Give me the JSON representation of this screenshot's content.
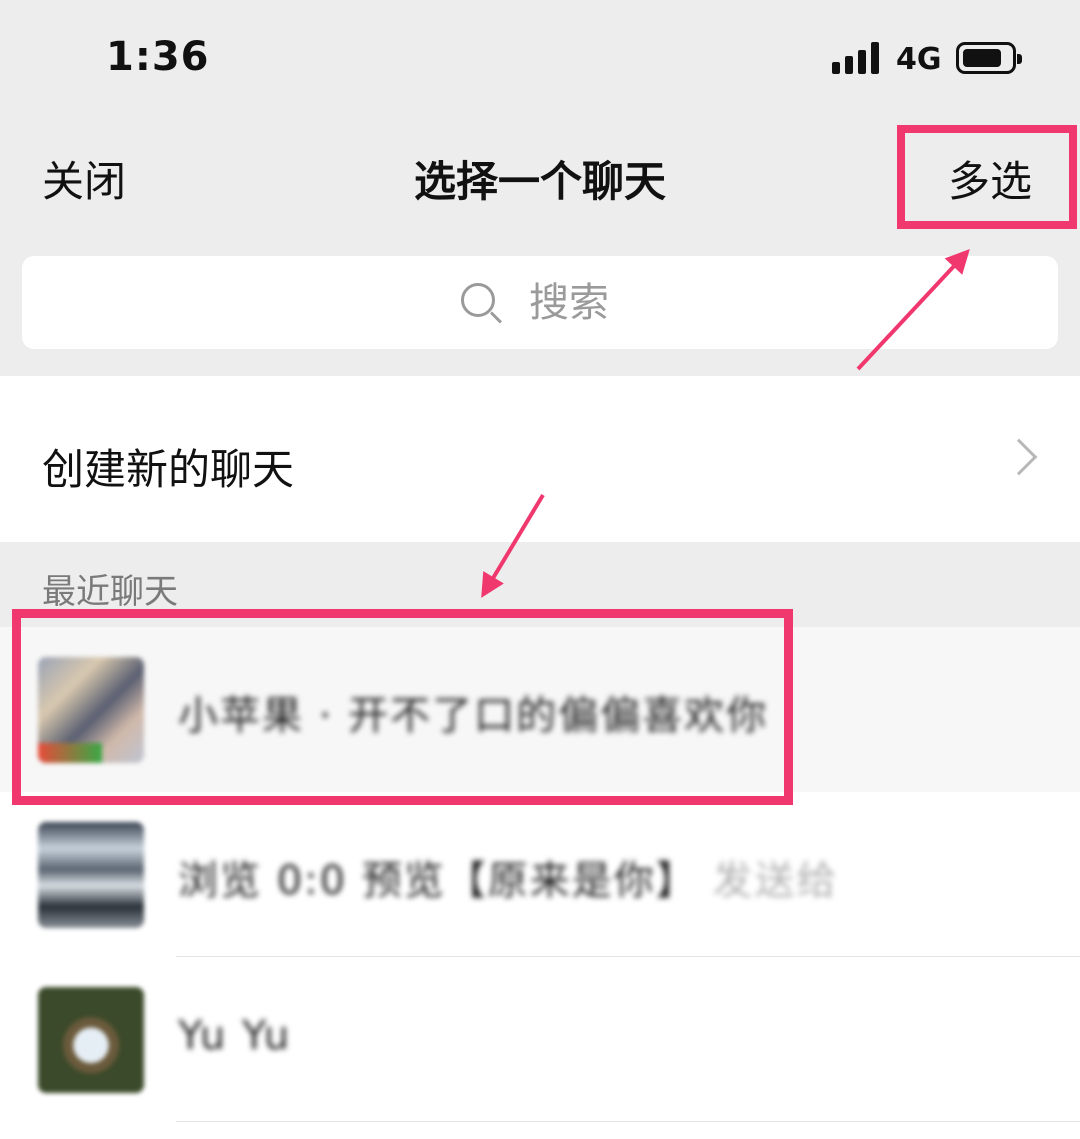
{
  "status_bar": {
    "time": "1:36",
    "network": "4G",
    "icons": [
      "signal-icon",
      "battery-icon"
    ]
  },
  "nav": {
    "close_label": "关闭",
    "title": "选择一个聊天",
    "multi_select_label": "多选"
  },
  "search": {
    "placeholder": "搜索",
    "icon": "search-icon"
  },
  "create_chat": {
    "label": "创建新的聊天",
    "icon": "chevron-right-icon"
  },
  "recent": {
    "section_label": "最近聊天",
    "chats": [
      {
        "name": "小苹果 · 开不了口的偏偏喜欢你"
      },
      {
        "name": "浏览 0:0 预览【原来是你】",
        "extra": "发送给"
      },
      {
        "name": "Yu Yu"
      }
    ]
  },
  "annotations": {
    "highlight_color": "#f0386e"
  }
}
